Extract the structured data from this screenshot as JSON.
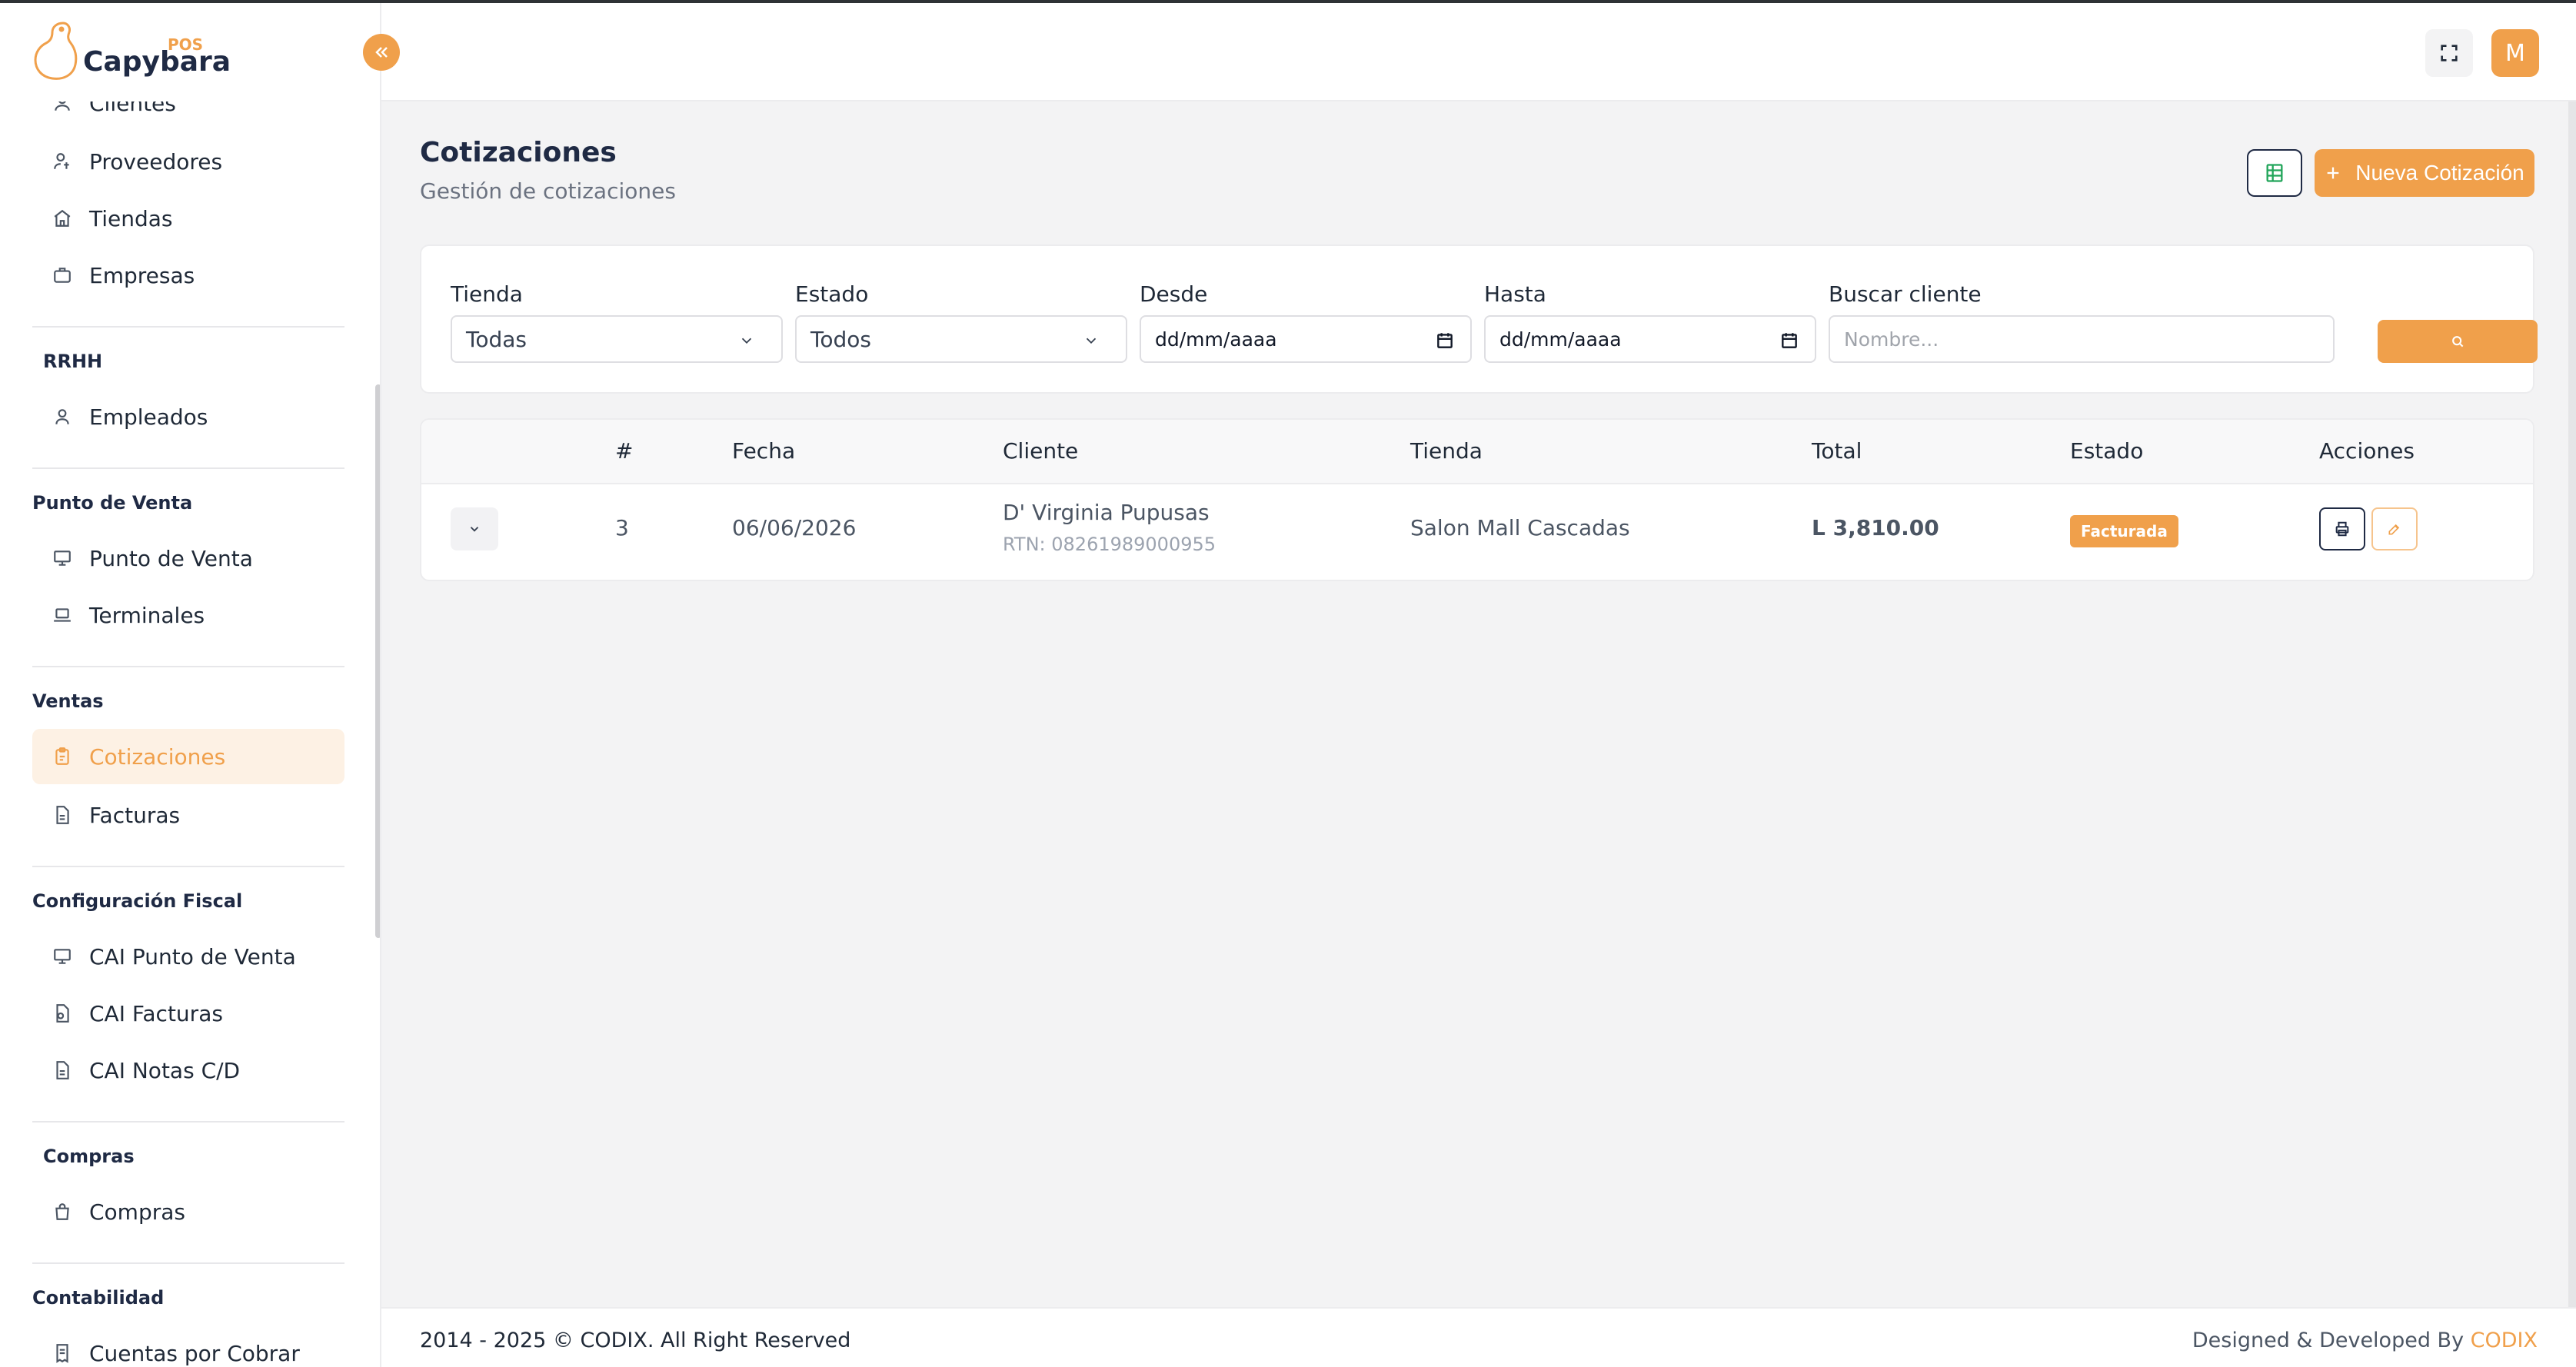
{
  "app": {
    "logo_pos": "POS",
    "logo_name": "Capybara",
    "avatar_initial": "M",
    "accent_color": "#f0a04b"
  },
  "sidebar": {
    "items_top": [
      {
        "label": "Clientes",
        "icon": "users-icon"
      },
      {
        "label": "Proveedores",
        "icon": "supplier-icon"
      },
      {
        "label": "Tiendas",
        "icon": "store-icon"
      },
      {
        "label": "Empresas",
        "icon": "briefcase-icon"
      }
    ],
    "sections": {
      "rrhh": "RRHH",
      "pos": "Punto de Venta",
      "ventas": "Ventas",
      "fiscal": "Configuración Fiscal",
      "compras": "Compras",
      "contabilidad": "Contabilidad"
    },
    "items": {
      "empleados": "Empleados",
      "punto_venta": "Punto de Venta",
      "terminales": "Terminales",
      "cotizaciones": "Cotizaciones",
      "facturas": "Facturas",
      "cai_pos": "CAI Punto de Venta",
      "cai_facturas": "CAI Facturas",
      "cai_notas": "CAI Notas C/D",
      "compras": "Compras",
      "cuentas_cobrar": "Cuentas por Cobrar"
    }
  },
  "page": {
    "title": "Cotizaciones",
    "subtitle": "Gestión de cotizaciones",
    "new_button": "Nueva Cotización"
  },
  "filters": {
    "tienda_label": "Tienda",
    "tienda_value": "Todas",
    "estado_label": "Estado",
    "estado_value": "Todos",
    "desde_label": "Desde",
    "desde_value": "dd/mm/aaaa",
    "hasta_label": "Hasta",
    "hasta_value": "dd/mm/aaaa",
    "buscar_label": "Buscar cliente",
    "buscar_placeholder": "Nombre..."
  },
  "table": {
    "headers": [
      "#",
      "Fecha",
      "Cliente",
      "Tienda",
      "Total",
      "Estado",
      "Acciones"
    ],
    "rows": [
      {
        "num": "3",
        "fecha": "06/06/2026",
        "cliente": "D' Virginia Pupusas",
        "rtn": "RTN: 08261989000955",
        "tienda": "Salon Mall Cascadas",
        "total": "L 3,810.00",
        "estado": "Facturada"
      }
    ]
  },
  "footer": {
    "left": "2014 - 2025 © CODIX. All Right Reserved",
    "right_prefix": "Designed & Developed By ",
    "right_brand": "CODIX"
  }
}
